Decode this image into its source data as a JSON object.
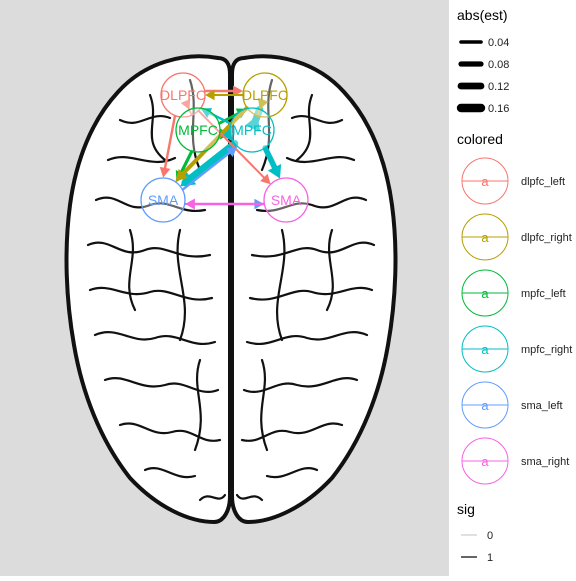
{
  "chart_data": {
    "type": "network",
    "nodes": [
      {
        "id": "dlpfc_left",
        "label": "DLPFC",
        "color": "#F8766D",
        "hemisphere": "left",
        "region": "dlpfc"
      },
      {
        "id": "dlpfc_right",
        "label": "DLPFC",
        "color": "#B79F00",
        "hemisphere": "right",
        "region": "dlpfc"
      },
      {
        "id": "mpfc_left",
        "label": "MPFC",
        "color": "#00BA38",
        "hemisphere": "left",
        "region": "mpfc"
      },
      {
        "id": "mpfc_right",
        "label": "MPFC",
        "color": "#00BFC4",
        "hemisphere": "right",
        "region": "mpfc"
      },
      {
        "id": "sma_left",
        "label": "SMA",
        "color": "#619CFF",
        "hemisphere": "left",
        "region": "sma"
      },
      {
        "id": "sma_right",
        "label": "SMA",
        "color": "#F564E3",
        "hemisphere": "right",
        "region": "sma"
      }
    ],
    "edges": [
      {
        "from": "dlpfc_left",
        "to": "dlpfc_right",
        "est": 0.04,
        "sig": 1
      },
      {
        "from": "dlpfc_right",
        "to": "dlpfc_left",
        "est": 0.03,
        "sig": 1
      },
      {
        "from": "mpfc_left",
        "to": "dlpfc_right",
        "est": 0.05,
        "sig": 1
      },
      {
        "from": "mpfc_right",
        "to": "dlpfc_left",
        "est": 0.04,
        "sig": 1
      },
      {
        "from": "dlpfc_left",
        "to": "mpfc_left",
        "est": 0.03,
        "sig": 1
      },
      {
        "from": "mpfc_left",
        "to": "mpfc_right",
        "est": 0.04,
        "sig": 1
      },
      {
        "from": "mpfc_right",
        "to": "mpfc_left",
        "est": 0.12,
        "sig": 1
      },
      {
        "from": "mpfc_right",
        "to": "dlpfc_right",
        "est": 0.16,
        "sig": 1
      },
      {
        "from": "dlpfc_left",
        "to": "sma_left",
        "est": 0.04,
        "sig": 1
      },
      {
        "from": "mpfc_left",
        "to": "sma_left",
        "est": 0.06,
        "sig": 1
      },
      {
        "from": "mpfc_right",
        "to": "sma_left",
        "est": 0.16,
        "sig": 1
      },
      {
        "from": "dlpfc_right",
        "to": "sma_left",
        "est": 0.08,
        "sig": 1
      },
      {
        "from": "mpfc_right",
        "to": "sma_right",
        "est": 0.12,
        "sig": 1
      },
      {
        "from": "dlpfc_right",
        "to": "mpfc_right",
        "est": 0.05,
        "sig": 1
      },
      {
        "from": "sma_left",
        "to": "sma_right",
        "est": 0.03,
        "sig": 1
      },
      {
        "from": "sma_right",
        "to": "sma_left",
        "est": 0.04,
        "sig": 1
      },
      {
        "from": "dlpfc_left",
        "to": "sma_right",
        "est": 0.03,
        "sig": 1
      },
      {
        "from": "sma_left",
        "to": "mpfc_right",
        "est": 0.04,
        "sig": 1
      }
    ],
    "legend_position": "right",
    "legends": {
      "width": {
        "title": "abs(est)",
        "entries": [
          {
            "label": "0.04",
            "value": 0.04
          },
          {
            "label": "0.08",
            "value": 0.08
          },
          {
            "label": "0.12",
            "value": 0.12
          },
          {
            "label": "0.16",
            "value": 0.16
          }
        ]
      },
      "color": {
        "title": "colored",
        "glyph": "a",
        "entries": [
          {
            "label": "dlpfc_left",
            "color": "#F8766D"
          },
          {
            "label": "dlpfc_right",
            "color": "#B79F00"
          },
          {
            "label": "mpfc_left",
            "color": "#00BA38"
          },
          {
            "label": "mpfc_right",
            "color": "#00BFC4"
          },
          {
            "label": "sma_left",
            "color": "#619CFF"
          },
          {
            "label": "sma_right",
            "color": "#F564E3"
          }
        ]
      },
      "sig": {
        "title": "sig",
        "entries": [
          {
            "label": "0",
            "color": "#cccccc"
          },
          {
            "label": "1",
            "color": "#000000"
          }
        ]
      }
    },
    "panel_background": "#dcdcdc",
    "legend_background": "#ffffff"
  }
}
